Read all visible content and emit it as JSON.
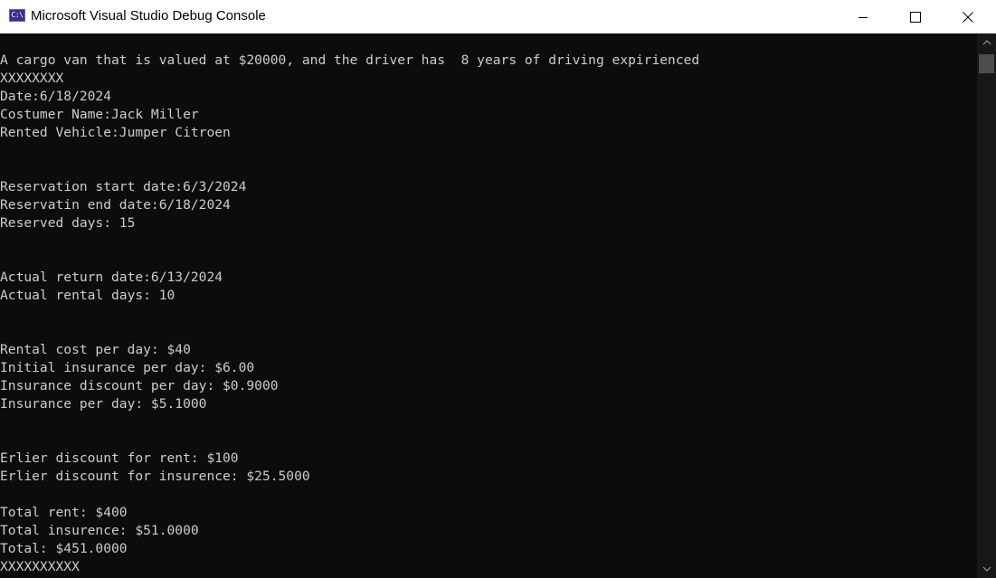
{
  "window": {
    "title": "Microsoft Visual Studio Debug Console",
    "icon": "console-app-icon",
    "icon_glyph": "C:\\",
    "controls": {
      "minimize": "minimize-icon",
      "maximize": "maximize-icon",
      "close": "close-icon"
    }
  },
  "console": {
    "background": "#0c0c0c",
    "text_color": "#cccccc",
    "lines": [
      "A cargo van that is valued at $20000, and the driver has  8 years of driving expiriенced",
      "XXXXXXXX",
      "Date:6/18/2024",
      "Costumer Name:Jack Miller",
      "Rented Vehicle:Jumper Citroen",
      "",
      "",
      "Reservation start date:6/3/2024",
      "Reservatin end date:6/18/2024",
      "Reserved days: 15",
      "",
      "",
      "Actual return date:6/13/2024",
      "Actual rental days: 10",
      "",
      "",
      "Rental cost per day: $40",
      "Initial insurance per day: $6.00",
      "Insurance discount per day: $0.9000",
      "Insurance per day: $5.1000",
      "",
      "",
      "Erlier discount for rent: $100",
      "Erlier discount for insurence: $25.5000",
      "",
      "Total rent: $400",
      "Total insurence: $51.0000",
      "Total: $451.0000",
      "XXXXXXXXXX"
    ]
  }
}
